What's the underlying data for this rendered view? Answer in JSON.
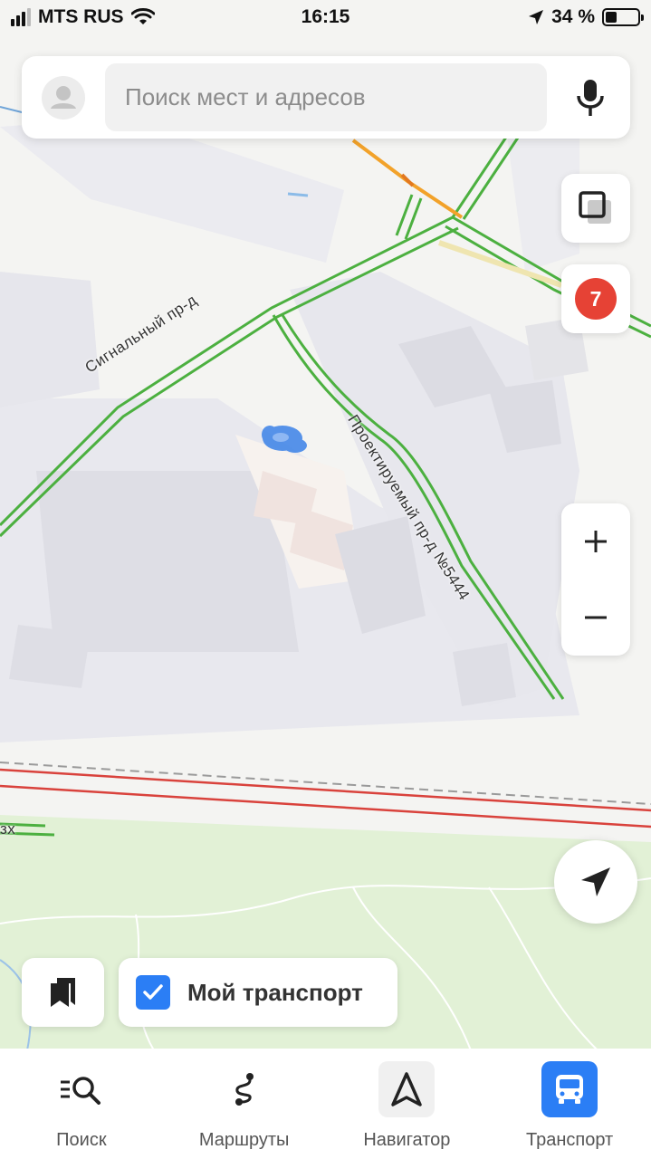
{
  "status_bar": {
    "carrier": "MTS RUS",
    "time": "16:15",
    "battery_percent": "34 %",
    "battery_level": 0.34
  },
  "search": {
    "placeholder": "Поиск мест и адресов"
  },
  "map": {
    "streets": {
      "signalny": "Сигнальный пр-д",
      "proektiruemy": "Проектируемый пр-д №5444",
      "fragment": "зх"
    },
    "traffic_score": "7"
  },
  "my_transport": {
    "label": "Мой транспорт",
    "checked": true
  },
  "bottom_nav": {
    "items": [
      {
        "label": "Поиск",
        "icon": "search-list-icon"
      },
      {
        "label": "Маршруты",
        "icon": "routes-icon"
      },
      {
        "label": "Навигатор",
        "icon": "navigator-icon"
      },
      {
        "label": "Транспорт",
        "icon": "bus-icon",
        "active": true
      }
    ]
  },
  "colors": {
    "accent": "#2b7ef5",
    "traffic_badge": "#e64235",
    "road_green": "#4cb040",
    "railway_red": "#d9423c"
  }
}
